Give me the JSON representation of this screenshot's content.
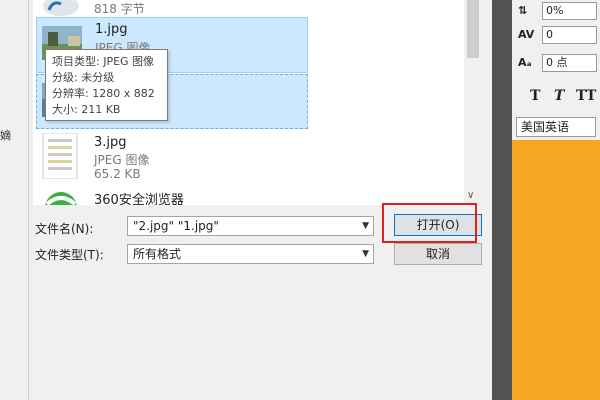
{
  "left_panel": {
    "label": "嫡"
  },
  "files": [
    {
      "name": "",
      "type": "",
      "size": "818 字节",
      "state": "normal"
    },
    {
      "name": "1.jpg",
      "type": "JPEG 图像",
      "size": "",
      "state": "selected"
    },
    {
      "name": "",
      "type": "",
      "size": "",
      "state": "selected-dashed"
    },
    {
      "name": "3.jpg",
      "type": "JPEG 图像",
      "size": "65.2 KB",
      "state": "normal"
    },
    {
      "name": "360安全浏览器",
      "type": "",
      "size": "",
      "state": "normal"
    }
  ],
  "tooltip": {
    "type": "项目类型: JPEG 图像",
    "rating": "分级: 未分级",
    "resolution": "分辨率: 1280 x 882",
    "size": "大小: 211 KB"
  },
  "filename": {
    "label": "文件名(N):",
    "value": "\"2.jpg\" \"1.jpg\""
  },
  "filetype": {
    "label": "文件类型(T):",
    "value": "所有格式"
  },
  "buttons": {
    "open": "打开(O)",
    "cancel": "取消"
  },
  "char_panel": {
    "tracking_value": "0%",
    "kerning_value": "0",
    "baseline_value": "0 点",
    "language": "美国英语",
    "style_buttons": [
      "T",
      "T",
      "TT"
    ]
  },
  "colors": {
    "selection": "#cce8ff",
    "highlight_box": "#e02020",
    "ps_dark": "#535353",
    "ps_orange": "#f5a623"
  }
}
